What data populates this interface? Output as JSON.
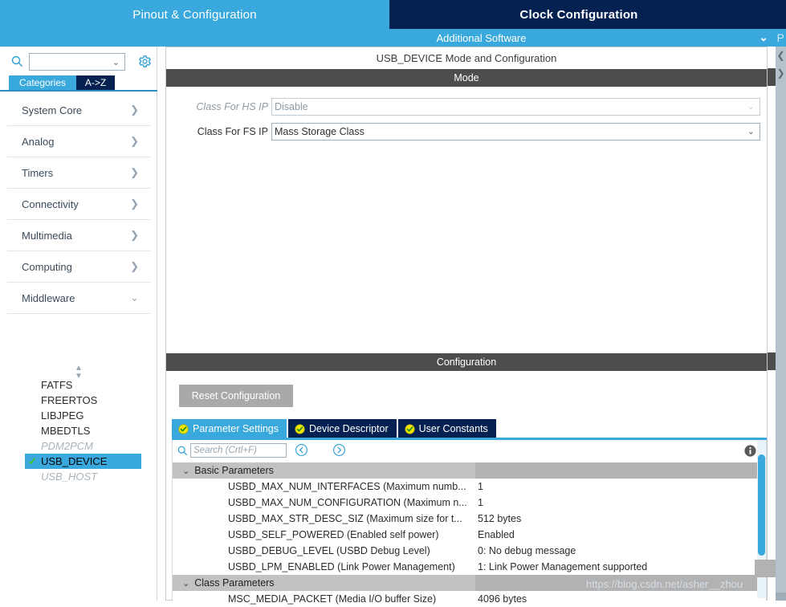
{
  "topbar": {
    "tabs": [
      {
        "label": "Pinout & Configuration",
        "state": "active"
      },
      {
        "label": "Clock Configuration",
        "state": "inactive"
      }
    ],
    "additional_software": "Additional Software",
    "additional_software_chevron": "chevron-down-icon",
    "right_partial_label": "P",
    "colors": {
      "active_tab": "#39a8dc",
      "inactive_tab": "#042152"
    }
  },
  "sidebar": {
    "search": {
      "value": "",
      "placeholder": ""
    },
    "search_icon": "search-icon",
    "gear_icon": "gear-icon",
    "tabs": [
      {
        "label": "Categories",
        "state": "active"
      },
      {
        "label": "A->Z",
        "state": "inactive"
      }
    ],
    "categories": [
      {
        "label": "System Core",
        "chevron": ">"
      },
      {
        "label": "Analog",
        "chevron": ">"
      },
      {
        "label": "Timers",
        "chevron": ">"
      },
      {
        "label": "Connectivity",
        "chevron": ">"
      },
      {
        "label": "Multimedia",
        "chevron": ">"
      },
      {
        "label": "Computing",
        "chevron": ">"
      },
      {
        "label": "Middleware",
        "chevron": "v"
      }
    ],
    "middleware_items": [
      {
        "label": "FATFS",
        "state": "normal",
        "checked": false
      },
      {
        "label": "FREERTOS",
        "state": "normal",
        "checked": false
      },
      {
        "label": "LIBJPEG",
        "state": "normal",
        "checked": false
      },
      {
        "label": "MBEDTLS",
        "state": "normal",
        "checked": false
      },
      {
        "label": "PDM2PCM",
        "state": "disabled",
        "checked": false
      },
      {
        "label": "USB_DEVICE",
        "state": "selected",
        "checked": true
      },
      {
        "label": "USB_HOST",
        "state": "disabled",
        "checked": false
      }
    ]
  },
  "main": {
    "panel_title": "USB_DEVICE Mode and Configuration",
    "mode": {
      "header": "Mode",
      "rows": [
        {
          "label": "Class For HS IP",
          "value": "Disable",
          "disabled": true
        },
        {
          "label": "Class For FS IP",
          "value": "Mass Storage Class",
          "disabled": false
        }
      ]
    },
    "configuration": {
      "header": "Configuration",
      "reset_button": "Reset Configuration",
      "tabs": [
        {
          "label": "Parameter Settings",
          "state": "active",
          "icon": "check-circle-icon"
        },
        {
          "label": "Device Descriptor",
          "state": "inactive",
          "icon": "check-circle-icon"
        },
        {
          "label": "User Constants",
          "state": "inactive",
          "icon": "check-circle-icon"
        }
      ],
      "toolbar": {
        "search_icon": "search-icon",
        "search_value": "",
        "search_placeholder": "Search (Crtl+F)",
        "prev_icon": "chevron-left-circle-icon",
        "next_icon": "chevron-right-circle-icon",
        "info_icon": "info-icon"
      },
      "groups": [
        {
          "name": "Basic Parameters",
          "expanded": true,
          "twisty": "v",
          "rows": [
            {
              "name": "USBD_MAX_NUM_INTERFACES (Maximum numb...",
              "value": "1"
            },
            {
              "name": "USBD_MAX_NUM_CONFIGURATION (Maximum n...",
              "value": "1"
            },
            {
              "name": "USBD_MAX_STR_DESC_SIZ (Maximum size for t...",
              "value": "512 bytes"
            },
            {
              "name": "USBD_SELF_POWERED (Enabled self power)",
              "value": "Enabled"
            },
            {
              "name": "USBD_DEBUG_LEVEL (USBD Debug Level)",
              "value": "0: No debug message"
            },
            {
              "name": "USBD_LPM_ENABLED (Link Power Management)",
              "value": "1: Link Power Management supported"
            }
          ]
        },
        {
          "name": "Class Parameters",
          "expanded": true,
          "twisty": "v",
          "rows": [
            {
              "name": "MSC_MEDIA_PACKET (Media I/O buffer Size)",
              "value": "4096 bytes"
            }
          ]
        }
      ]
    }
  },
  "right_strip": {
    "collapse_left_icon": "chevron-left-icon",
    "collapse_right_icon": "chevron-right-icon"
  },
  "watermark": "https://blog.csdn.net/asher__zhou"
}
